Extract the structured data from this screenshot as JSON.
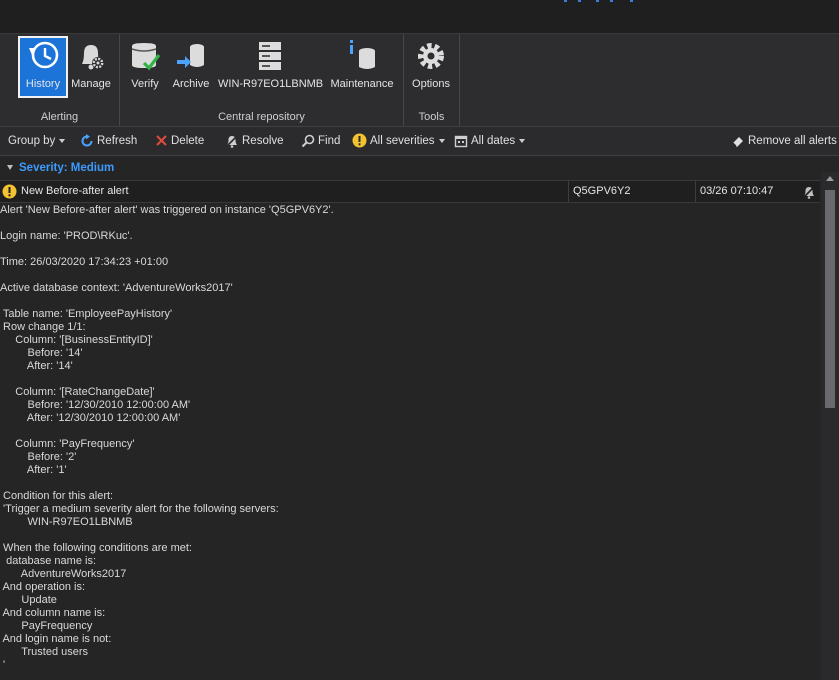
{
  "ribbon": {
    "groups": {
      "alerting": {
        "label": "Alerting",
        "buttons": [
          {
            "label": "History",
            "icon": "history-icon",
            "active": true
          },
          {
            "label": "Manage",
            "icon": "manage-alert-icon"
          }
        ]
      },
      "central_repository": {
        "label": "Central repository",
        "buttons": [
          {
            "label": "Verify",
            "icon": "verify-server-icon"
          },
          {
            "label": "Archive",
            "icon": "archive-database-icon"
          },
          {
            "label": "WIN-R97EO1LBNMB",
            "icon": "server-icon"
          },
          {
            "label": "Maintenance",
            "icon": "maintenance-database-icon"
          }
        ]
      },
      "tools": {
        "label": "Tools",
        "buttons": [
          {
            "label": "Options",
            "icon": "gear-icon"
          }
        ]
      }
    }
  },
  "toolbar": {
    "group_by": "Group by",
    "refresh": "Refresh",
    "delete": "Delete",
    "resolve": "Resolve",
    "find": "Find",
    "severities": "All severities",
    "dates": "All dates",
    "remove_all": "Remove all alerts"
  },
  "severity_group": {
    "title": "Severity: Medium"
  },
  "alert": {
    "name": "New Before-after alert",
    "instance": "Q5GPV6Y2",
    "time": "03/26 07:10:47"
  },
  "details": [
    "Alert 'New Before-after alert' was triggered on instance 'Q5GPV6Y2'.",
    "",
    "Login name: 'PROD\\RKuc'.",
    "",
    "Time: 26/03/2020 17:34:23 +01:00",
    "",
    "Active database context: 'AdventureWorks2017'",
    "",
    " Table name: 'EmployeePayHistory'",
    " Row change 1/1:",
    "     Column: '[BusinessEntityID]'",
    "         Before: '14'",
    "         After: '14'",
    "",
    "     Column: '[RateChangeDate]'",
    "         Before: '12/30/2010 12:00:00 AM'",
    "         After: '12/30/2010 12:00:00 AM'",
    "",
    "     Column: 'PayFrequency'",
    "         Before: '2'",
    "         After: '1'",
    "",
    " Condition for this alert:",
    " 'Trigger a medium severity alert for the following servers:",
    "         WIN-R97EO1LBNMB",
    "",
    " When the following conditions are met:",
    "  database name is:",
    "       AdventureWorks2017",
    " And operation is:",
    "       Update",
    " And column name is:",
    "       PayFrequency",
    " And login name is not:",
    "       Trusted users",
    " '"
  ],
  "colors": {
    "accent": "#1c74d8",
    "severity_text": "#3d9bff",
    "warning": "#f2c230",
    "delete": "#e24b3b",
    "refresh": "#4aa3ff"
  }
}
